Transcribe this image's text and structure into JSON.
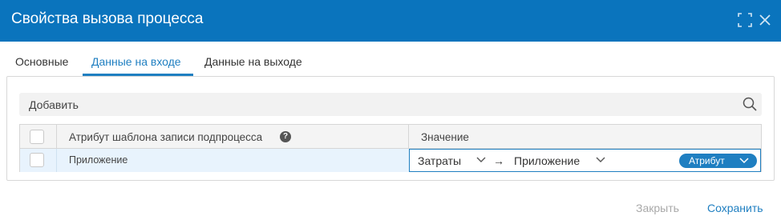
{
  "dialog": {
    "title": "Свойства вызова процесса",
    "icons": [
      "maximize-icon",
      "close-icon"
    ]
  },
  "tabs": [
    {
      "label": "Основные",
      "active": false
    },
    {
      "label": "Данные на входе",
      "active": true
    },
    {
      "label": "Данные на выходе",
      "active": false
    }
  ],
  "toolbar": {
    "add_label": "Добавить",
    "search_icon": "search-icon"
  },
  "grid": {
    "columns": [
      "Атрибут шаблона записи подпроцесса",
      "Значение"
    ],
    "help_glyph": "?",
    "rows": [
      {
        "attribute": "Приложение",
        "value": {
          "source": "Затраты",
          "arrow": "→",
          "target": "Приложение",
          "mode_button": "Атрибут"
        }
      }
    ]
  },
  "footer": {
    "close_label": "Закрыть",
    "save_label": "Сохранить"
  },
  "colors": {
    "titlebar": "#0a74bd",
    "accent": "#1f7fc1",
    "row_selected": "#e8f3fd"
  }
}
